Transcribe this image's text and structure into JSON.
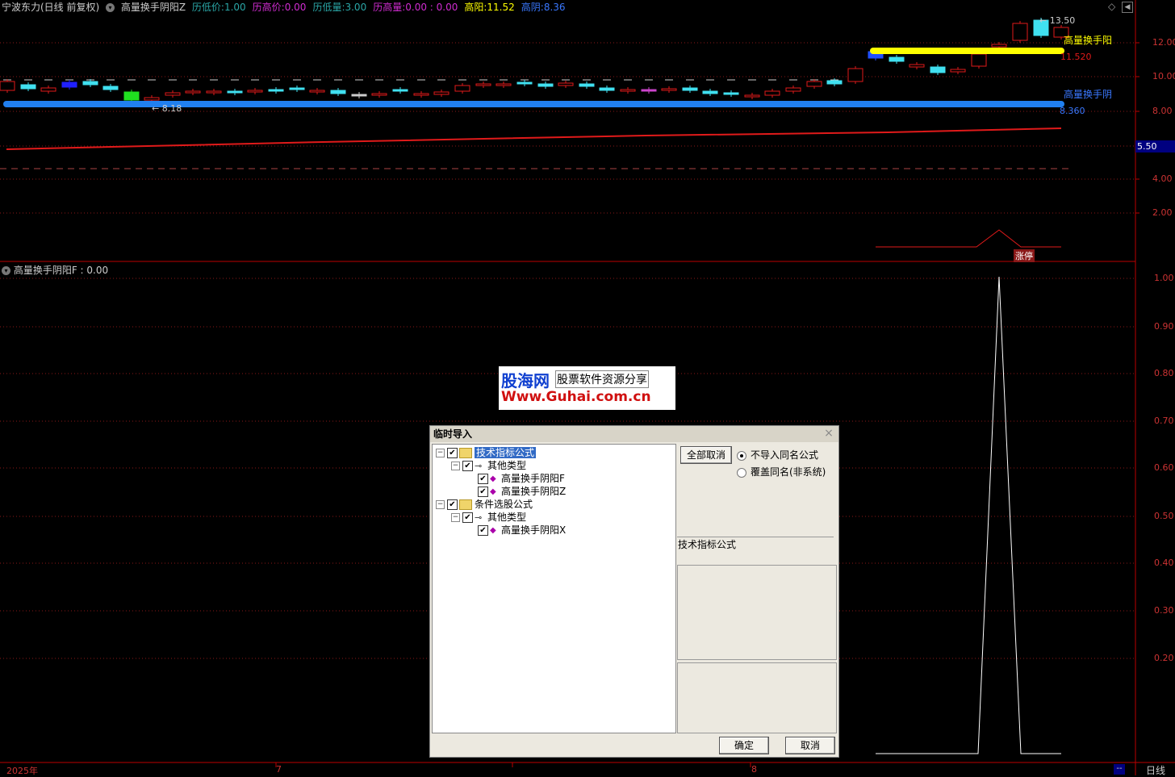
{
  "header": {
    "stock": "宁波东力(日线 前复权)",
    "indicator": "高量换手阴阳Z",
    "items": [
      {
        "label": "历低价:",
        "value": "1.00",
        "color": "#2aa6a6"
      },
      {
        "label": "历高价:",
        "value": "0.00",
        "color": "#d02cd0"
      },
      {
        "label": "历低量:",
        "value": "3.00",
        "color": "#2aa6a6"
      },
      {
        "label": "历高量:",
        "value": "0.00 : 0.00",
        "color": "#d02cd0"
      },
      {
        "label": "高阳:",
        "value": "11.52",
        "color": "#ffff00"
      },
      {
        "label": "高阴:",
        "value": "8.36",
        "color": "#3a78ff"
      }
    ]
  },
  "price_axis": [
    "12.00",
    "10.00",
    "8.00",
    "5.50",
    "4.00",
    "2.00"
  ],
  "price_markers": {
    "high": "13.50",
    "yang_label": "高量换手阳",
    "yang_value": "11.520",
    "yin_label": "高量换手阴",
    "yin_value": "8.360",
    "low_marker": "8.18",
    "zhangting": "涨停"
  },
  "sub_panel": {
    "title": "高量换手阴阳F : 0.00",
    "axis": [
      "1.00",
      "0.90",
      "0.80",
      "0.70",
      "0.60",
      "0.50",
      "0.40",
      "0.30",
      "0.20"
    ]
  },
  "time_axis": {
    "labels": [
      "2025年",
      "7",
      "8"
    ],
    "period": "日线",
    "dashes": "--"
  },
  "watermark": {
    "line1": "股海网",
    "line1b": "股票软件资源分享",
    "line2": "Www.Guhai.com.cn"
  },
  "dialog": {
    "title": "临时导入",
    "close": "×",
    "tree": [
      {
        "level": 0,
        "expander": "−",
        "checked": true,
        "icon": "folder",
        "label": "技术指标公式",
        "selected": true
      },
      {
        "level": 1,
        "expander": "−",
        "checked": true,
        "icon": "key",
        "label": "其他类型",
        "selected": false
      },
      {
        "level": 2,
        "expander": "",
        "checked": true,
        "icon": "formula",
        "label": "高量换手阴阳F",
        "selected": false
      },
      {
        "level": 2,
        "expander": "",
        "checked": true,
        "icon": "formula",
        "label": "高量换手阴阳Z",
        "selected": false
      },
      {
        "level": 0,
        "expander": "−",
        "checked": true,
        "icon": "folder",
        "label": "条件选股公式",
        "selected": false
      },
      {
        "level": 1,
        "expander": "−",
        "checked": true,
        "icon": "key",
        "label": "其他类型",
        "selected": false
      },
      {
        "level": 2,
        "expander": "",
        "checked": true,
        "icon": "formula",
        "label": "高量换手阴阳X",
        "selected": false
      }
    ],
    "cancel_all": "全部取消",
    "radio_no_import": "不导入同名公式",
    "radio_overwrite": "覆盖同名(非系统)",
    "info_label": "技术指标公式",
    "ok": "确定",
    "cancel": "取消"
  }
}
